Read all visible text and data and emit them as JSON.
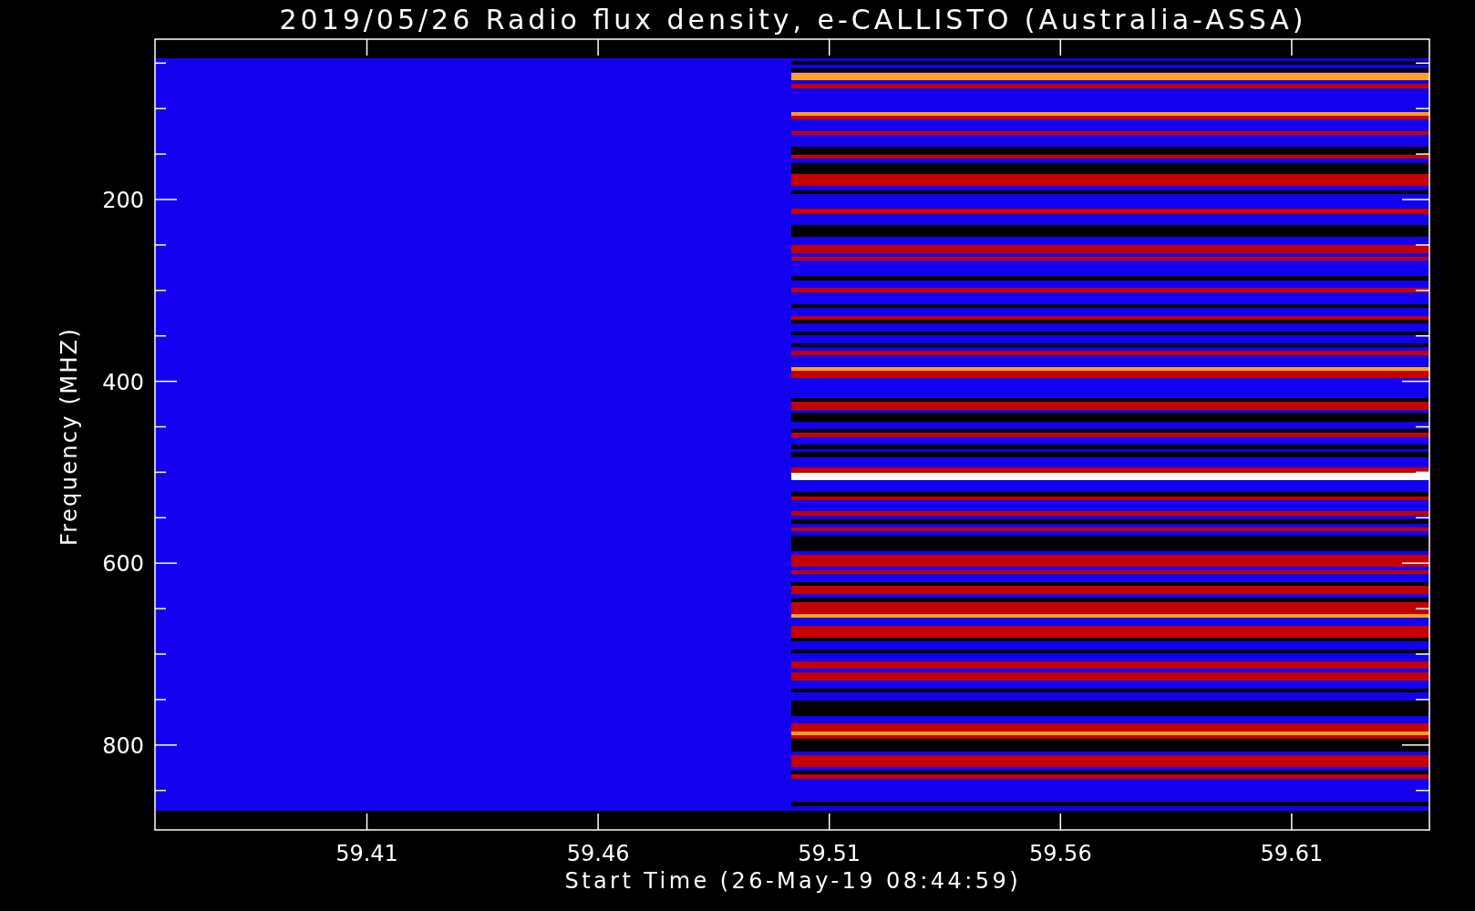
{
  "chart": {
    "title": "2019/05/26  Radio flux density, e-CALLISTO (Australia-ASSA)",
    "y_axis": {
      "label": "Frequency (MHZ)",
      "ticks": [
        "200",
        "400",
        "600",
        "800"
      ]
    },
    "x_axis": {
      "label": "Start Time (26-May-19 08:44:59)",
      "ticks": [
        "59.41",
        "59.46",
        "59.51",
        "59.56",
        "59.61"
      ]
    }
  }
}
